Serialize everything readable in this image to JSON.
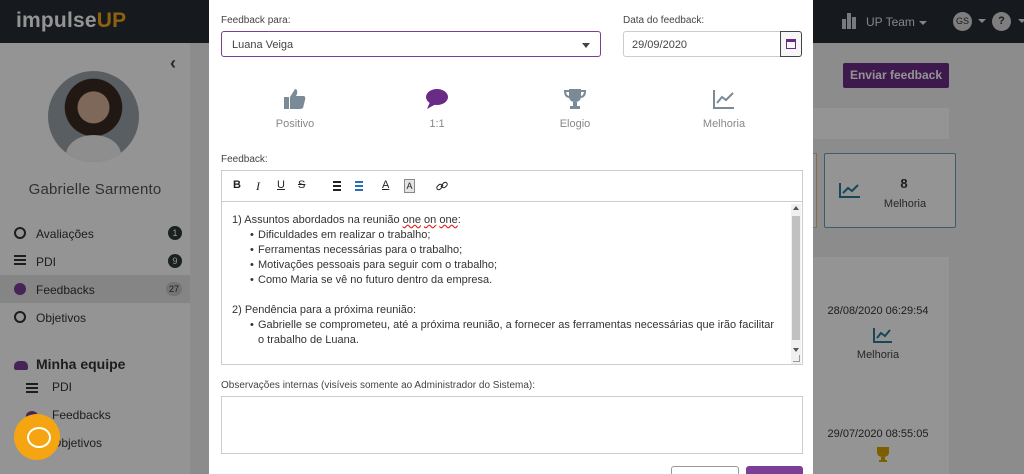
{
  "app": {
    "logo_main": "impulse",
    "logo_accent": "UP",
    "team_label": "UP Team",
    "user_initials": "GS",
    "help_label": "?"
  },
  "sidebar": {
    "user_name": "Gabrielle Sarmento",
    "items": [
      {
        "label": "Avaliações",
        "badge": "1",
        "icon": "circle-progress-icon"
      },
      {
        "label": "PDI",
        "badge": "9",
        "icon": "list-icon"
      },
      {
        "label": "Feedbacks",
        "badge": "27",
        "icon": "chat-icon",
        "active": true
      },
      {
        "label": "Objetivos",
        "badge": "",
        "icon": "target-icon"
      }
    ],
    "team_section": "Minha equipe",
    "team_items": [
      {
        "label": "PDI"
      },
      {
        "label": "Feedbacks"
      },
      {
        "label": "Objetivos"
      }
    ]
  },
  "background": {
    "send_button": "Enviar feedback",
    "stat_card": {
      "number": "8",
      "label": "Melhoria"
    },
    "entries": [
      {
        "date": "28/08/2020 06:29:54",
        "type": "Melhoria"
      },
      {
        "date": "29/07/2020 08:55:05",
        "type": ""
      }
    ]
  },
  "modal": {
    "feedback_for_label": "Feedback para:",
    "feedback_for_value": "Luana Veiga",
    "date_label": "Data do feedback:",
    "date_value": "29/09/2020",
    "types": [
      {
        "label": "Positivo",
        "icon": "thumbs-up-icon",
        "selected": false
      },
      {
        "label": "1:1",
        "icon": "chat-bubble-icon",
        "selected": true
      },
      {
        "label": "Elogio",
        "icon": "trophy-icon",
        "selected": false
      },
      {
        "label": "Melhoria",
        "icon": "chart-line-icon",
        "selected": false
      }
    ],
    "feedback_label": "Feedback:",
    "toolbar": {
      "bold": "B",
      "italic": "I",
      "underline": "U",
      "strike": "S",
      "font_color": "A",
      "bg_color": "A"
    },
    "content": {
      "heading1_pre": "1) Assuntos abordados na reunião ",
      "heading1_w1": "one",
      "heading1_mid": " ",
      "heading1_w2": "on",
      "heading1_mid2": " ",
      "heading1_w3": "one",
      "heading1_post": ":",
      "bullets1": [
        "Dificuldades em realizar o trabalho;",
        "Ferramentas necessárias para o trabalho;",
        "Motivações pessoais para seguir com o trabalho;",
        "Como Maria se vê no futuro dentro da empresa."
      ],
      "heading2": "2) Pendência para a próxima reunião:",
      "bullets2": [
        "Gabrielle se comprometeu, até a próxima reunião, a fornecer as ferramentas necessárias que irão facilitar o trabalho de Luana."
      ]
    },
    "obs_label": "Observações internas (visíveis somente ao Administrador do Sistema):",
    "colors": {
      "accent": "#6a2b86",
      "brand_orange": "#f2a81d"
    }
  }
}
